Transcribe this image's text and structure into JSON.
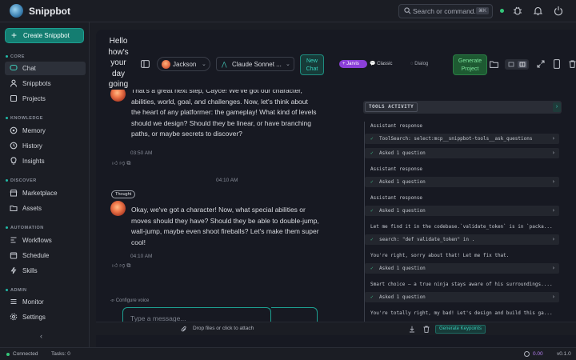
{
  "app": {
    "name": "Snippbot"
  },
  "search": {
    "placeholder": "Search or command...",
    "shortcut": "⌘K"
  },
  "sidebar": {
    "create_label": "Create Snippbot",
    "sections": [
      {
        "title": "CORE",
        "items": [
          {
            "label": "Chat",
            "icon": "chat-icon",
            "active": true
          },
          {
            "label": "Snippbots",
            "icon": "user-icon"
          },
          {
            "label": "Projects",
            "icon": "square-icon"
          }
        ]
      },
      {
        "title": "KNOWLEDGE",
        "items": [
          {
            "label": "Memory",
            "icon": "memory-icon"
          },
          {
            "label": "History",
            "icon": "clock-icon"
          },
          {
            "label": "Insights",
            "icon": "bulb-icon"
          }
        ]
      },
      {
        "title": "DISCOVER",
        "items": [
          {
            "label": "Marketplace",
            "icon": "store-icon"
          },
          {
            "label": "Assets",
            "icon": "folder-icon"
          }
        ]
      },
      {
        "title": "AUTOMATION",
        "items": [
          {
            "label": "Workflows",
            "icon": "workflow-icon"
          },
          {
            "label": "Schedule",
            "icon": "calendar-icon"
          },
          {
            "label": "Skills",
            "icon": "lightning-icon"
          }
        ]
      },
      {
        "title": "ADMIN",
        "items": [
          {
            "label": "Monitor",
            "icon": "monitor-icon"
          },
          {
            "label": "Settings",
            "icon": "gear-icon"
          }
        ]
      }
    ]
  },
  "header": {
    "greeting": "Hello how's your day going",
    "persona": "Jackson",
    "model": "Claude Sonnet ...",
    "new_chat": "New Chat",
    "mode_jarvis": "+ Jarvis",
    "mode_classic": "Classic",
    "mode_dialog": "Dialog",
    "generate_project": "Generate Project"
  },
  "chat": {
    "messages": [
      {
        "text": "That's a great next step, Cayce! We've got our character, abilities, world, goal, and challenges. Now, let's think about the heart of any platformer: the gameplay! What kind of levels should we design? Should they be linear, or have branching paths, or maybe secrets to discover?",
        "time": "03:50 AM"
      },
      {
        "badge": "Thought",
        "text": "Okay, we've got a character! Now, what special abilities or moves should they have? Should they be able to double-jump, wall-jump, maybe even shoot fireballs? Let's make them super cool!",
        "time": "04:10 AM"
      }
    ],
    "divider_time": "04:10 AM",
    "configure_voice": "Configure voice",
    "input_placeholder": "Type a message...",
    "attach": "Drop files or click to attach",
    "generate_keypoints": "Generate Keypoints"
  },
  "tools": {
    "title": "TOOLS ACTIVITY",
    "entries": [
      {
        "kind": "label",
        "text": "Assistant response"
      },
      {
        "kind": "call",
        "text": "ToolSearch: select:mcp__snippbot-tools__ask_questions"
      },
      {
        "kind": "call",
        "text": "Asked 1 question"
      },
      {
        "kind": "label",
        "text": "Assistant response"
      },
      {
        "kind": "call",
        "text": "Asked 1 question"
      },
      {
        "kind": "label",
        "text": "Assistant response"
      },
      {
        "kind": "call",
        "text": "Asked 1 question"
      },
      {
        "kind": "label",
        "text": "Let me find it in the codebase.`validate_token` is in `packa..."
      },
      {
        "kind": "call",
        "text": "search: \"def validate_token\" in ."
      },
      {
        "kind": "label",
        "text": "You're right, sorry about that! Let me fix that."
      },
      {
        "kind": "call",
        "text": "Asked 1 question"
      },
      {
        "kind": "label",
        "text": "Smart choice — a true ninja stays aware of his surroundings...."
      },
      {
        "kind": "call",
        "text": "Asked 1 question"
      },
      {
        "kind": "label",
        "text": "You're totally right, my bad! Let's design and build this ga..."
      }
    ]
  },
  "status": {
    "connected": "Connected",
    "tasks": "Tasks: 0",
    "cost": "0.00",
    "version": "v0.1.0"
  },
  "colors": {
    "accent": "#147d71",
    "jarvis": "#8b3fd9",
    "success": "#35c77a"
  }
}
